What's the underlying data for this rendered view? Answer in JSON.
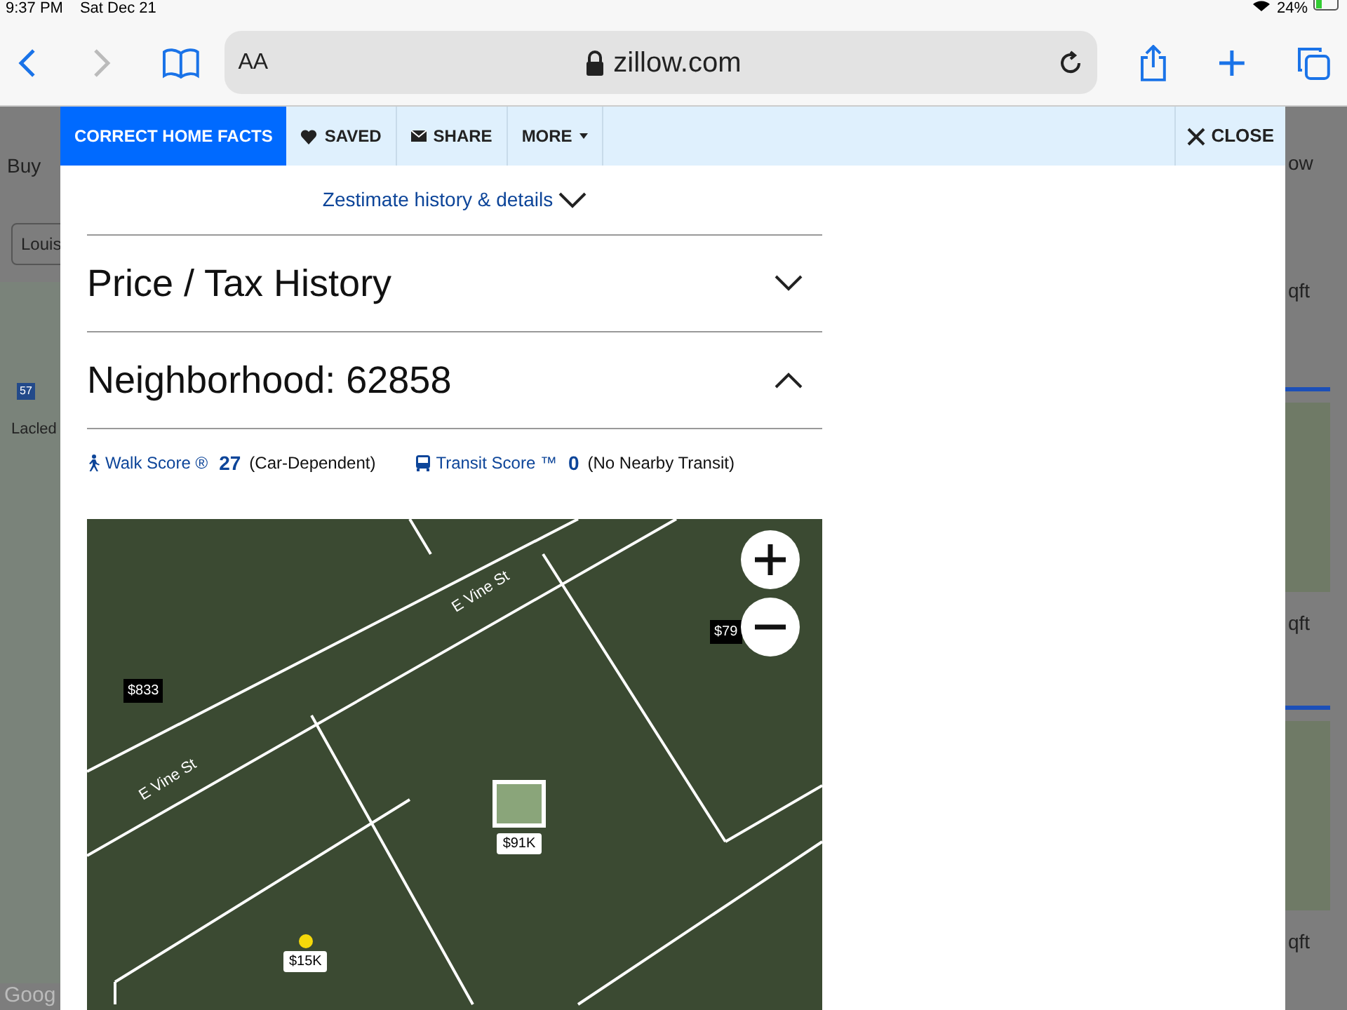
{
  "status_bar": {
    "time": "9:37 PM",
    "date": "Sat Dec 21",
    "battery": "24%"
  },
  "browser": {
    "text_size": "AA",
    "address": "zillow.com"
  },
  "background_page": {
    "left_texts": [
      "Buy",
      "Louis",
      "Lacled",
      "Goog"
    ],
    "highway_shield": "57",
    "right_texts": [
      "ow",
      "qft",
      "qft",
      "qft"
    ]
  },
  "modal": {
    "toolbar": [
      {
        "kind": "primary",
        "label": "CORRECT HOME FACTS"
      },
      {
        "kind": "heart",
        "label": "SAVED"
      },
      {
        "kind": "mail",
        "label": "SHARE"
      },
      {
        "kind": "menu",
        "label": "MORE"
      }
    ],
    "close": "CLOSE",
    "zestimate_link": "Zestimate history & details",
    "sections": [
      {
        "title": "Price / Tax History",
        "expanded": false
      },
      {
        "title": "Neighborhood: 62858",
        "expanded": true
      }
    ],
    "scores": [
      {
        "kind": "walk",
        "label": "Walk Score ®",
        "value": "27",
        "note": "(Car-Dependent)"
      },
      {
        "kind": "transit",
        "label": "Transit Score ™",
        "value": "0",
        "note": "(No Nearby Transit)"
      }
    ],
    "map": {
      "streets": [
        "E Vine St",
        "E Vine St"
      ],
      "prices": [
        {
          "kind": "plain",
          "label": "$833"
        },
        {
          "kind": "plain",
          "label": "$79"
        },
        {
          "kind": "photo",
          "label": "$91K"
        },
        {
          "kind": "dot",
          "label": "$15K"
        }
      ]
    }
  }
}
